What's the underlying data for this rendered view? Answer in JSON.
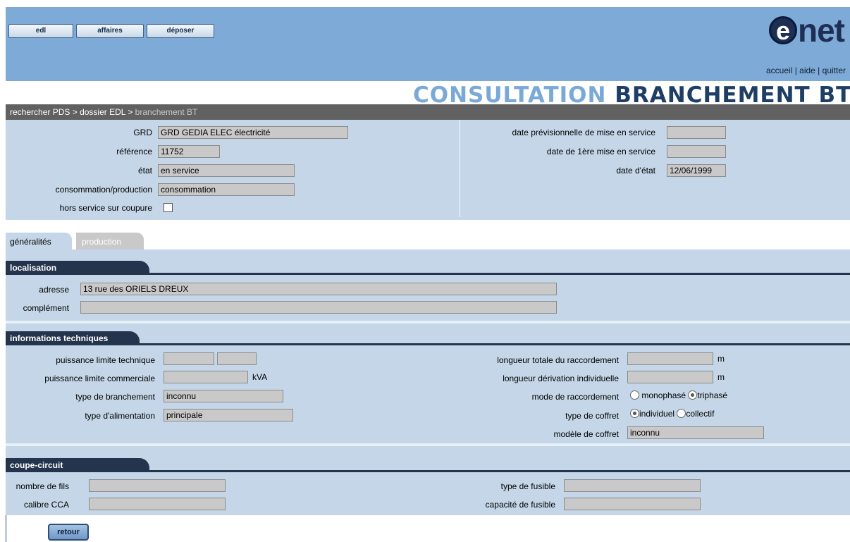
{
  "nav": {
    "buttons": [
      "edl",
      "affaires",
      "déposer"
    ]
  },
  "logo": {
    "e": "e",
    "net": "net"
  },
  "toplinks": {
    "accueil": "accueil",
    "sep": " | ",
    "aide": "aide",
    "quitter": "quitter"
  },
  "title": {
    "highlight": "CONSULTATION",
    "rest": " BRANCHEMENT BT"
  },
  "breadcrumb": {
    "items": [
      "rechercher PDS >",
      "dossier EDL >",
      "branchement BT"
    ]
  },
  "head": {
    "grd_label": "GRD",
    "grd": "GRD GEDIA ELEC électricité",
    "reference_label": "référence",
    "reference": "11752",
    "etat_label": "état",
    "etat": "en service",
    "conso_label": "consommation/production",
    "conso": "consommation",
    "hors_service_label": "hors service sur coupure",
    "date_prev_label": "date prévisionnelle de mise en service",
    "date_prev": "",
    "date_1ere_label": "date de 1ère mise en service",
    "date_1ere": "",
    "date_etat_label": "date d'état",
    "date_etat": "12/06/1999"
  },
  "tabs": {
    "generalites": "généralités",
    "production": "production"
  },
  "localisation": {
    "section": "localisation",
    "adresse_label": "adresse",
    "adresse": "13 rue des ORIELS DREUX",
    "complement_label": "complément",
    "complement": ""
  },
  "tech": {
    "section": "informations techniques",
    "pl_technique_label": "puissance limite technique",
    "pl_commerciale_label": "puissance limite commerciale",
    "kva": "kVA",
    "type_branchement_label": "type de branchement",
    "type_branchement": "inconnu",
    "type_alim_label": "type d'alimentation",
    "type_alim": "principale",
    "longueur_totale_label": "longueur totale du raccordement",
    "m1": "m",
    "longueur_deriv_label": "longueur dérivation individuelle",
    "m2": "m",
    "mode_label": "mode de raccordement",
    "mono": "monophasé",
    "tri": "triphasé",
    "coffret_label": "type de coffret",
    "individuel": "individuel",
    "collectif": "collectif",
    "modele_label": "modèle de coffret",
    "modele": "inconnu"
  },
  "coupe": {
    "section": "coupe-circuit",
    "fils_label": "nombre de fils",
    "calibre_label": "calibre CCA",
    "type_fusible_label": "type de fusible",
    "capacite_label": "capacité de fusible"
  },
  "retour": "retour"
}
